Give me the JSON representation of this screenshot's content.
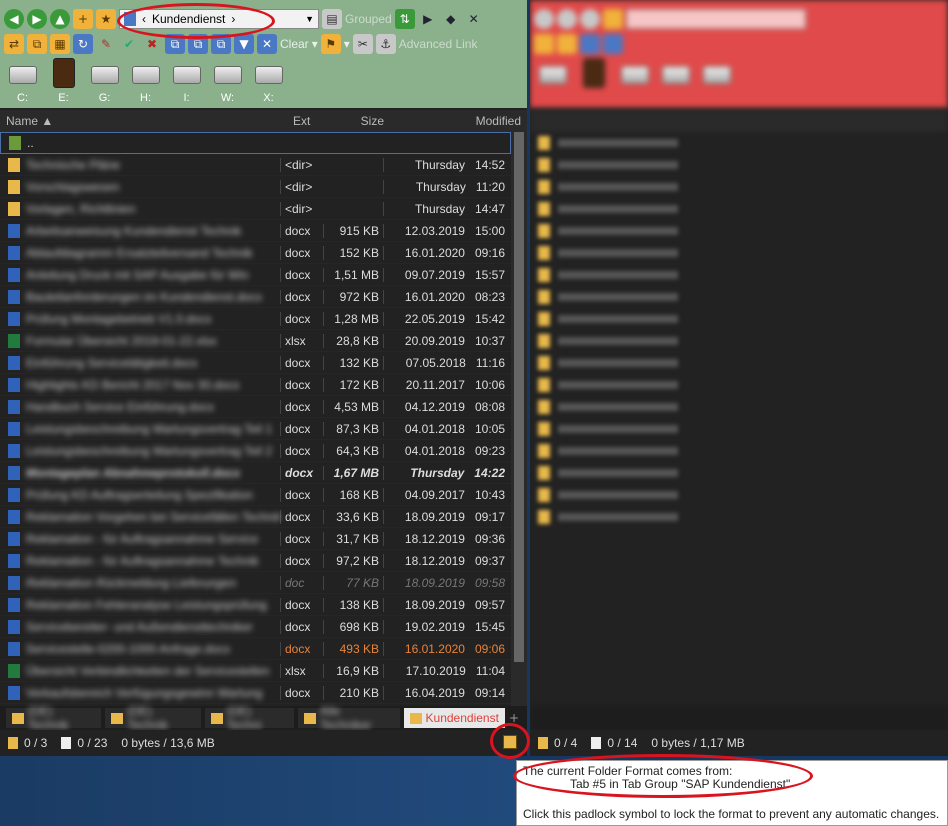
{
  "left": {
    "toolbar": {
      "path": "Kundendienst",
      "grouped_label": "Grouped",
      "clear_label": "Clear",
      "advanced_link_label": "Advanced Link"
    },
    "drives": [
      "C:",
      "E:",
      "G:",
      "H:",
      "I:",
      "W:",
      "X:"
    ],
    "columns": {
      "name": "Name",
      "ext": "Ext",
      "size": "Size",
      "modified": "Modified"
    },
    "files": [
      {
        "name": "..",
        "ext": "",
        "size": "",
        "date": "",
        "time": "",
        "type": "up",
        "style": "selected"
      },
      {
        "name": "Technische Pläne",
        "ext": "<dir>",
        "size": "",
        "date": "Thursday",
        "time": "14:52",
        "type": "folder",
        "style": ""
      },
      {
        "name": "Vorschlagswesen",
        "ext": "<dir>",
        "size": "",
        "date": "Thursday",
        "time": "11:20",
        "type": "folder",
        "style": ""
      },
      {
        "name": "Vorlagen, Richtlinien",
        "ext": "<dir>",
        "size": "",
        "date": "Thursday",
        "time": "14:47",
        "type": "folder",
        "style": ""
      },
      {
        "name": "Arbeitsanweisung Kundendienst Technik",
        "ext": "docx",
        "size": "915 KB",
        "date": "12.03.2019",
        "time": "15:00",
        "type": "word",
        "style": ""
      },
      {
        "name": "Ablaufdiagramm Ersatzteilversand Technik",
        "ext": "docx",
        "size": "152 KB",
        "date": "16.01.2020",
        "time": "09:16",
        "type": "word",
        "style": ""
      },
      {
        "name": "Anleitung Druck mit SAP Ausgabe für Win",
        "ext": "docx",
        "size": "1,51 MB",
        "date": "09.07.2019",
        "time": "15:57",
        "type": "word",
        "style": ""
      },
      {
        "name": "Bauteilanforderungen im Kundendienst.docx",
        "ext": "docx",
        "size": "972 KB",
        "date": "16.01.2020",
        "time": "08:23",
        "type": "word",
        "style": ""
      },
      {
        "name": "Prüfung Montagebetrieb V1.0.docx",
        "ext": "docx",
        "size": "1,28 MB",
        "date": "22.05.2019",
        "time": "15:42",
        "type": "word",
        "style": ""
      },
      {
        "name": "Formular Übersicht 2019-01-22.xlsx",
        "ext": "xlsx",
        "size": "28,8 KB",
        "date": "20.09.2019",
        "time": "10:37",
        "type": "excel",
        "style": ""
      },
      {
        "name": "Einführung Servicetätigkeit.docx",
        "ext": "docx",
        "size": "132 KB",
        "date": "07.05.2018",
        "time": "11:16",
        "type": "word",
        "style": ""
      },
      {
        "name": "Highlights KD Bericht 2017 Nov 30.docx",
        "ext": "docx",
        "size": "172 KB",
        "date": "20.11.2017",
        "time": "10:06",
        "type": "word",
        "style": ""
      },
      {
        "name": "Handbuch Service Einführung.docx",
        "ext": "docx",
        "size": "4,53 MB",
        "date": "04.12.2019",
        "time": "08:08",
        "type": "word",
        "style": ""
      },
      {
        "name": "Leistungsbeschreibung Wartungsvertrag Teil 1",
        "ext": "docx",
        "size": "87,3 KB",
        "date": "04.01.2018",
        "time": "10:05",
        "type": "word",
        "style": ""
      },
      {
        "name": "Leistungsbeschreibung Wartungsvertrag Teil 2",
        "ext": "docx",
        "size": "64,3 KB",
        "date": "04.01.2018",
        "time": "09:23",
        "type": "word",
        "style": ""
      },
      {
        "name": "Montageplan Abnahmeprotokoll.docx",
        "ext": "docx",
        "size": "1,67 MB",
        "date": "Thursday",
        "time": "14:22",
        "type": "word",
        "style": "bold"
      },
      {
        "name": "Prüfung KD Auftragserteilung Spezifikation",
        "ext": "docx",
        "size": "168 KB",
        "date": "04.09.2017",
        "time": "10:43",
        "type": "word",
        "style": ""
      },
      {
        "name": "Reklamation Vorgehen bei Servicefällen Technik",
        "ext": "docx",
        "size": "33,6 KB",
        "date": "18.09.2019",
        "time": "09:17",
        "type": "word",
        "style": ""
      },
      {
        "name": "Reklamation - für Auftragsannahme Service",
        "ext": "docx",
        "size": "31,7 KB",
        "date": "18.12.2019",
        "time": "09:36",
        "type": "word",
        "style": ""
      },
      {
        "name": "Reklamation - für Auftragsannahme Technik",
        "ext": "docx",
        "size": "97,2 KB",
        "date": "18.12.2019",
        "time": "09:37",
        "type": "word",
        "style": ""
      },
      {
        "name": "Reklamation Rückmeldung Lieferungen",
        "ext": "doc",
        "size": "77 KB",
        "date": "18.09.2019",
        "time": "09:58",
        "type": "word",
        "style": "dim"
      },
      {
        "name": "Reklamation Fehleranalyse Leistungsprüfung",
        "ext": "docx",
        "size": "138 KB",
        "date": "18.09.2019",
        "time": "09:57",
        "type": "word",
        "style": ""
      },
      {
        "name": "Servicebereiter- und Außendiensttechniker",
        "ext": "docx",
        "size": "698 KB",
        "date": "19.02.2019",
        "time": "15:45",
        "type": "word",
        "style": ""
      },
      {
        "name": "Servicestelle-0200-1000-Anfrage.docx",
        "ext": "docx",
        "size": "493 KB",
        "date": "16.01.2020",
        "time": "09:06",
        "type": "word",
        "style": "orange"
      },
      {
        "name": "Übersicht Verbindlichkeiten der Servicestellen",
        "ext": "xlsx",
        "size": "16,9 KB",
        "date": "17.10.2019",
        "time": "11:04",
        "type": "excel",
        "style": ""
      },
      {
        "name": "Verkaufsbereich Verfügungsgewinn Wartung",
        "ext": "docx",
        "size": "210 KB",
        "date": "16.04.2019",
        "time": "09:14",
        "type": "word",
        "style": ""
      }
    ],
    "tabs": [
      {
        "label": "(DE) Technik",
        "active": false
      },
      {
        "label": "(DE) Technik",
        "active": false
      },
      {
        "label": "(DE) Techni",
        "active": false
      },
      {
        "label": "Alle Techniker",
        "active": false
      },
      {
        "label": "Kundendienst",
        "active": true
      }
    ],
    "status": {
      "folders": "0 / 3",
      "files": "0 / 23",
      "bytes": "0 bytes / 13,6 MB"
    }
  },
  "right": {
    "status": {
      "folders": "0 / 4",
      "files": "0 / 14",
      "bytes": "0 bytes / 1,17 MB"
    }
  },
  "tooltip": {
    "line1": "The current Folder Format comes from:",
    "line2": "Tab #5 in Tab Group \"SAP Kundendienst\"",
    "line3": "Click this padlock symbol to lock the format to prevent any automatic changes."
  }
}
